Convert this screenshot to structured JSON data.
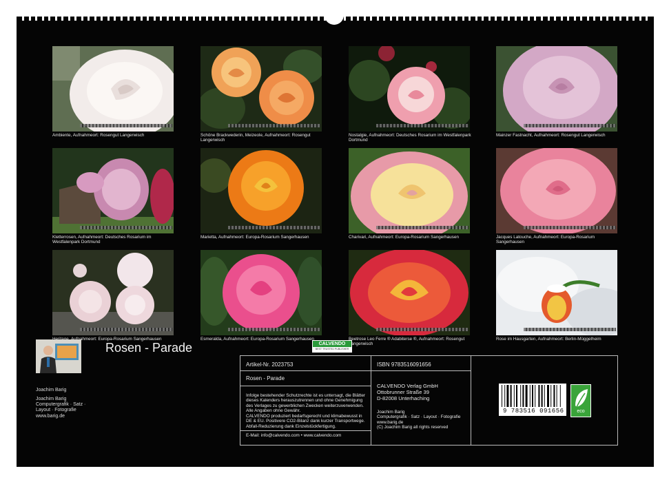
{
  "calendar": {
    "title": "Rosen - Parade",
    "photos": [
      {
        "caption": "Ambiente, Aufnahmeort: Rosengut Langerwisch",
        "icon": "white-rose-photo"
      },
      {
        "caption": "Schöne Brackwederin, Meizeole, Aufnahmeort: Rosengut Langerwisch",
        "icon": "orange-roses-photo"
      },
      {
        "caption": "Nostalgie, Aufnahmeort: Deutsches Rosarium im Westfalenpark Dortmund",
        "icon": "pink-white-rose-photo"
      },
      {
        "caption": "Mainzer Fastnacht, Aufnahmeort: Rosengut Langerwisch",
        "icon": "lavender-rose-photo"
      },
      {
        "caption": "Kletterrosen, Aufnahmeort: Deutsches Rosarium im Westfalenpark Dortmund",
        "icon": "climbing-roses-photo"
      },
      {
        "caption": "Marietta, Aufnahmeort: Europa-Rosarium Sangerhausen",
        "icon": "orange-rose-photo"
      },
      {
        "caption": "Charivari, Aufnahmeort: Europa-Rosarium Sangerhausen",
        "icon": "yellow-pink-rose-photo"
      },
      {
        "caption": "Jacques Latouche, Aufnahmeort: Europa-Rosarium Sangerhausen",
        "icon": "pink-rose-photo"
      },
      {
        "caption": "Heritage, Aufnahmeort: Europa-Rosarium Sangerhausen",
        "icon": "pale-roses-photo"
      },
      {
        "caption": "Esmeralda, Aufnahmeort: Europa-Rosarium Sangerhausen",
        "icon": "hot-pink-rose-photo"
      },
      {
        "caption": "Beetrose Leo Ferre ® Adabiterse ®, Aufnahmeort: Rosengut Langerwisch",
        "icon": "red-yellow-rose-photo"
      },
      {
        "caption": "Rose im Hausgarten, Aufnahmeort: Berlin-Müggelheim",
        "icon": "rose-in-snow-photo"
      }
    ]
  },
  "author": {
    "name": "Joachim Barig",
    "lines": [
      "Joachim Barig",
      "Computergrafik · Satz ·",
      "Layout · Fotografie",
      "www.barig.de"
    ]
  },
  "imprint": {
    "article": "Artikel-Nr. 2023753",
    "product_title": "Rosen - Parade",
    "copyright_notice": "Infolge bestehender Schutzrechte ist es untersagt, die Blätter dieses Kalenders herauszutrennen und ohne Genehmigung des Verlages zu gewerblichen Zwecken weiterzuverwenden. Alle Angaben ohne Gewähr.",
    "production_notice": "CALVENDO produziert bedarfsgerecht und klimabewusst in DE & EU. Positivere CO2-Bilanz dank kurzer Transportwege. Abfall-Reduzierung dank Einzelstückfertigung.",
    "contact": "E-Mail: info@calvendo.com • www.calvendo.com",
    "isbn": "ISBN 9783516091656",
    "publisher_lines": [
      "CALVENDO Verlag GmbH",
      "Ottobrunner Straße 39",
      "D-82008 Unterhaching"
    ],
    "design_lines": [
      "Joachim Barig",
      "Computergrafik · Satz · Layout · Fotografie",
      "www.barig.de",
      "(C) Joachim Barig all rights reserved"
    ],
    "barcode_number": "9 783516 091656",
    "badge_brand": "CALVENDO",
    "badge_sub": "BEST TRUSTED PUBLISHER",
    "eco_label": "eco"
  }
}
